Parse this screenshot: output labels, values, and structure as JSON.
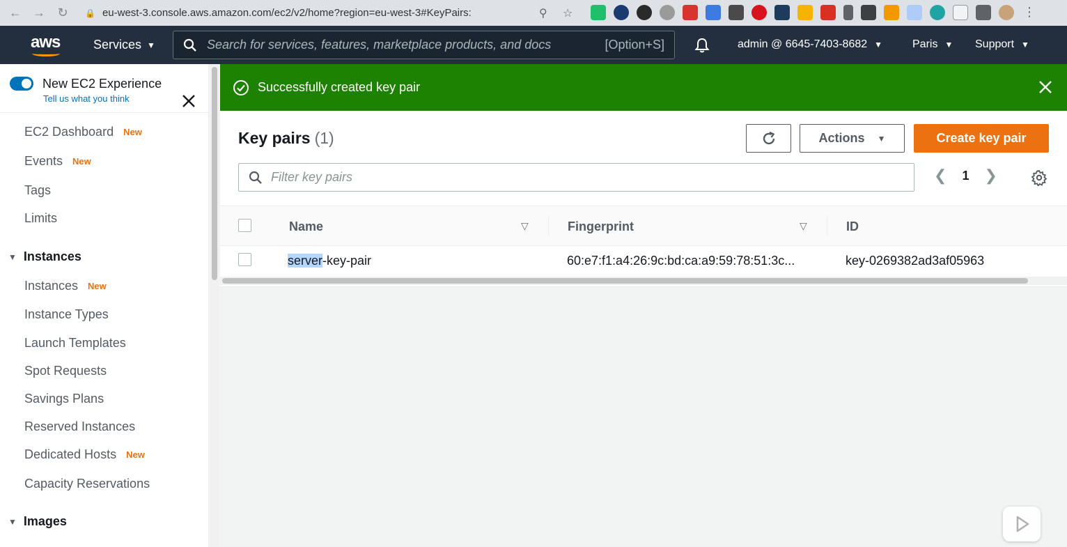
{
  "browser": {
    "url": "eu-west-3.console.aws.amazon.com/ec2/v2/home?region=eu-west-3#KeyPairs:"
  },
  "topnav": {
    "logo": "aws",
    "services": "Services",
    "search_placeholder": "Search for services, features, marketplace products, and docs",
    "search_shortcut": "[Option+S]",
    "account": "admin @ 6645-7403-8682",
    "region": "Paris",
    "support": "Support"
  },
  "sidebar": {
    "toggle_title": "New EC2 Experience",
    "toggle_link": "Tell us what you think",
    "new_badge": "New",
    "items": [
      {
        "label": "EC2 Dashboard",
        "new": true
      },
      {
        "label": "Events",
        "new": true
      },
      {
        "label": "Tags",
        "new": false
      },
      {
        "label": "Limits",
        "new": false
      }
    ],
    "sections": [
      {
        "title": "Instances",
        "items": [
          {
            "label": "Instances",
            "new": true
          },
          {
            "label": "Instance Types",
            "new": false
          },
          {
            "label": "Launch Templates",
            "new": false
          },
          {
            "label": "Spot Requests",
            "new": false
          },
          {
            "label": "Savings Plans",
            "new": false
          },
          {
            "label": "Reserved Instances",
            "new": false
          },
          {
            "label": "Dedicated Hosts",
            "new": true
          },
          {
            "label": "Capacity Reservations",
            "new": false
          }
        ]
      },
      {
        "title": "Images",
        "items": []
      }
    ]
  },
  "flash": {
    "message": "Successfully created key pair"
  },
  "panel": {
    "title": "Key pairs",
    "count": "(1)",
    "actions_label": "Actions",
    "create_label": "Create key pair",
    "filter_placeholder": "Filter key pairs",
    "page": "1",
    "columns": [
      "Name",
      "Fingerprint",
      "ID"
    ],
    "rows": [
      {
        "name_selected": "server",
        "name_rest": "-key-pair",
        "fingerprint": "60:e7:f1:a4:26:9c:bd:ca:a9:59:78:51:3c...",
        "id": "key-0269382ad3af05963"
      }
    ]
  },
  "colors": {
    "aws_navy": "#232f3e",
    "aws_orange": "#ec7211",
    "success_green": "#1d8102",
    "link_blue": "#0073bb"
  }
}
